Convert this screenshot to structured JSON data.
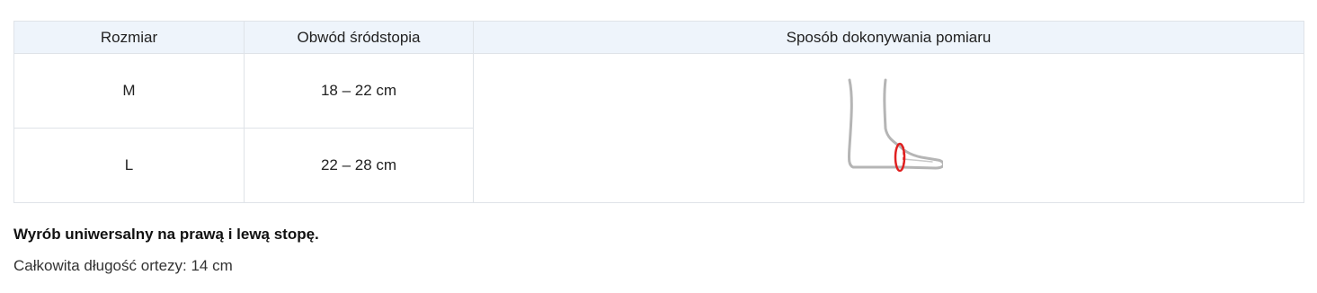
{
  "table": {
    "headers": [
      "Rozmiar",
      "Obwód śródstopia",
      "Sposób dokonywania pomiaru"
    ],
    "rows": [
      {
        "size": "M",
        "circumference": "18 – 22 cm"
      },
      {
        "size": "L",
        "circumference": "22 – 28 cm"
      }
    ],
    "measure_image": {
      "icon": "foot-measurement-icon",
      "outline_color": "#b5b5b5",
      "marker_color": "#e02020"
    }
  },
  "notes": {
    "bold": "Wyrób uniwersalny na prawą i lewą stopę.",
    "length": "Całkowita długość ortezy: 14 cm"
  }
}
